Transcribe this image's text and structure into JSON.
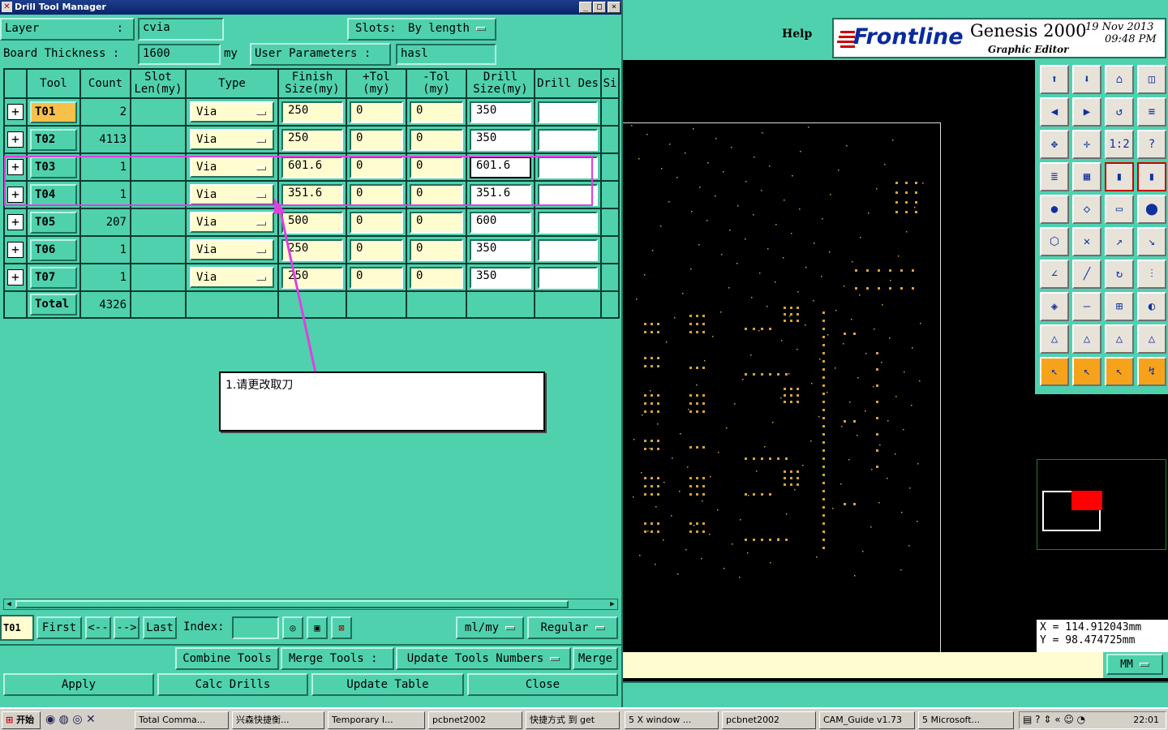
{
  "window": {
    "title": "Drill Tool Manager"
  },
  "top": {
    "layer_label": "Layer",
    "layer_colon": ":",
    "layer_value": "cvia",
    "slots_label": "Slots:",
    "slots_value": "By length",
    "thickness_label": "Board Thickness :",
    "thickness_value": "1600",
    "thickness_unit": "my",
    "userparam_label": "User Parameters :",
    "userparam_value": "hasl"
  },
  "table": {
    "headers": [
      "Tool",
      "Count",
      "Slot Len(my)",
      "Type",
      "Finish Size(my)",
      "+Tol (my)",
      "-Tol (my)",
      "Drill Size(my)",
      "Drill Des",
      "Si"
    ],
    "rows": [
      {
        "tool": "T01",
        "count": "2",
        "type": "Via",
        "finish": "250",
        "ptol": "0",
        "mtol": "0",
        "drill": "350",
        "des": ""
      },
      {
        "tool": "T02",
        "count": "4113",
        "type": "Via",
        "finish": "250",
        "ptol": "0",
        "mtol": "0",
        "drill": "350",
        "des": ""
      },
      {
        "tool": "T03",
        "count": "1",
        "type": "Via",
        "finish": "601.6",
        "ptol": "0",
        "mtol": "0",
        "drill": "601.6",
        "des": ""
      },
      {
        "tool": "T04",
        "count": "1",
        "type": "Via",
        "finish": "351.6",
        "ptol": "0",
        "mtol": "0",
        "drill": "351.6",
        "des": ""
      },
      {
        "tool": "T05",
        "count": "207",
        "type": "Via",
        "finish": "500",
        "ptol": "0",
        "mtol": "0",
        "drill": "600",
        "des": ""
      },
      {
        "tool": "T06",
        "count": "1",
        "type": "Via",
        "finish": "250",
        "ptol": "0",
        "mtol": "0",
        "drill": "350",
        "des": ""
      },
      {
        "tool": "T07",
        "count": "1",
        "type": "Via",
        "finish": "250",
        "ptol": "0",
        "mtol": "0",
        "drill": "350",
        "des": ""
      }
    ],
    "total_label": "Total",
    "total_count": "4326"
  },
  "annotation": {
    "text": "1.请更改取刀"
  },
  "nav": {
    "current": "T01",
    "first": "First",
    "prev": "<--",
    "next": "-->",
    "last": "Last",
    "index_label": "Index:",
    "units": "ml/my",
    "mode": "Regular"
  },
  "actions": {
    "combine": "Combine Tools",
    "merge_tools": "Merge Tools :",
    "update_numbers": "Update Tools Numbers",
    "merge": "Merge",
    "apply": "Apply",
    "calc": "Calc Drills",
    "update_table": "Update Table",
    "close": "Close"
  },
  "genesis": {
    "help": "Help",
    "brand": "Frontline",
    "product": "Genesis 2000",
    "subtitle": "Graphic Editor",
    "date": "19 Nov 2013",
    "time": "09:48 PM",
    "x_readout": "X = 114.912043mm",
    "y_readout": "Y = 98.474725mm",
    "units": "MM"
  },
  "taskbar": {
    "start": "开始",
    "tasks": [
      "Total Comma...",
      "兴森快捷衡...",
      "Temporary I...",
      "pcbnet2002",
      "快捷方式 到 get",
      "5 X window ...",
      "pcbnet2002",
      "CAM_Guide v1.73",
      "5 Microsoft..."
    ],
    "clock": "22:01"
  },
  "colors": {
    "panel": "#4fd1ae",
    "cell": "#fffdd0",
    "annotation": "#e040e0",
    "pads": "#d4a53a"
  }
}
